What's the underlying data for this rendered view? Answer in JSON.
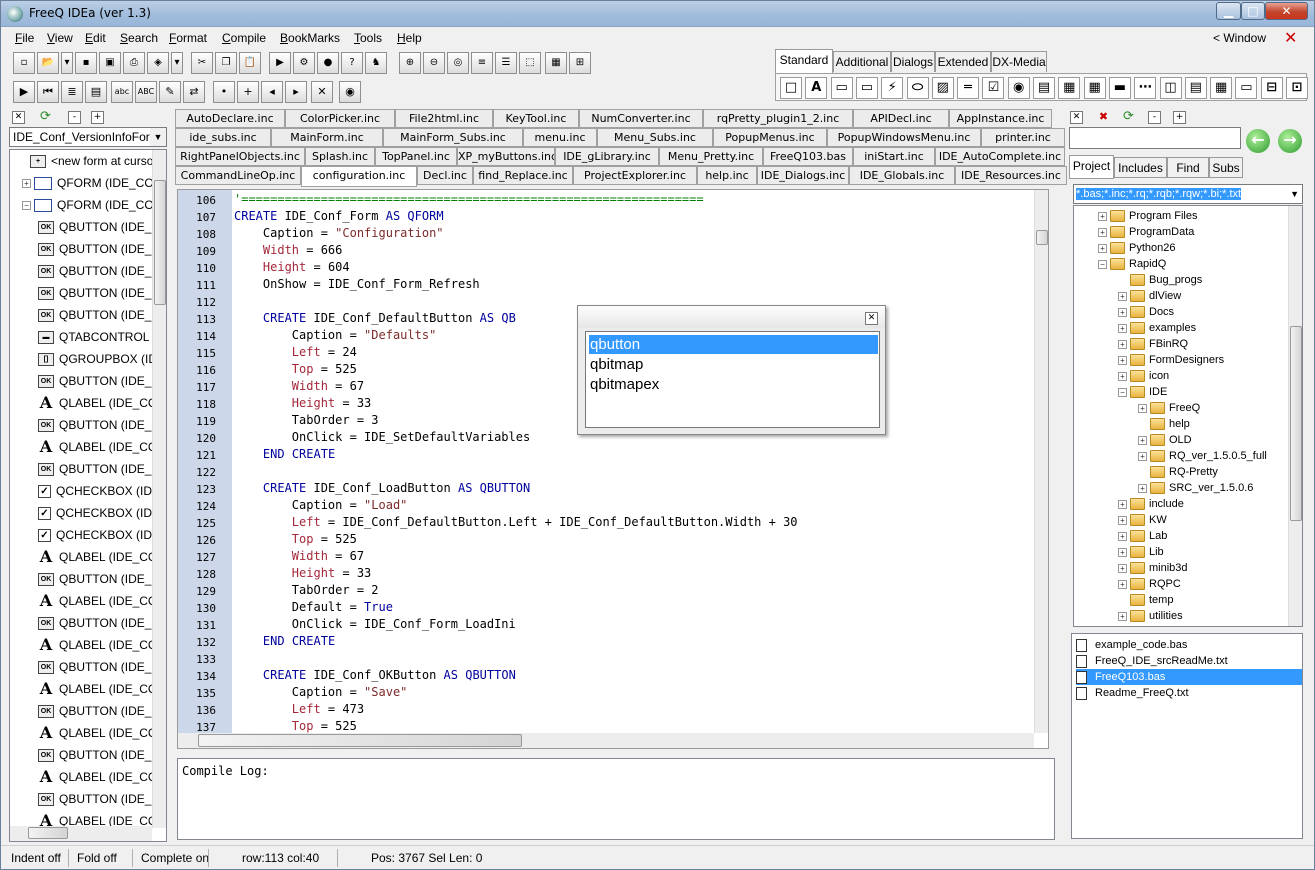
{
  "window": {
    "title": "FreeQ IDEa (ver 1.3)",
    "window_menu_label": "< Window",
    "close_glyph": "✕"
  },
  "menu": [
    "File",
    "View",
    "Edit",
    "Search",
    "Format",
    "Compile",
    "BookMarks",
    "Tools",
    "Help"
  ],
  "palette": {
    "tabs": [
      "Standard",
      "Additional",
      "Dialogs",
      "Extended",
      "DX-Media"
    ],
    "active_tab": 0
  },
  "left_panel": {
    "combo_value": "IDE_Conf_VersionInfoForm A",
    "tree_items": [
      {
        "icon": "new-form-icon",
        "label": "<new form at cursor>"
      },
      {
        "icon": "form-icon",
        "label": "QFORM  (IDE_CON"
      },
      {
        "icon": "form-icon",
        "label": "QFORM  (IDE_CON"
      },
      {
        "icon": "button-icon",
        "label": "QBUTTON  (IDE_"
      },
      {
        "icon": "button-icon",
        "label": "QBUTTON  (IDE_"
      },
      {
        "icon": "button-icon",
        "label": "QBUTTON  (IDE_"
      },
      {
        "icon": "button-icon",
        "label": "QBUTTON  (IDE_"
      },
      {
        "icon": "button-icon",
        "label": "QBUTTON  (IDE_"
      },
      {
        "icon": "tabcontrol-icon",
        "label": "QTABCONTROL"
      },
      {
        "icon": "groupbox-icon",
        "label": "QGROUPBOX  (ID"
      },
      {
        "icon": "button-icon",
        "label": "QBUTTON  (IDE_"
      },
      {
        "icon": "label-icon",
        "label": "QLABEL  (IDE_CC"
      },
      {
        "icon": "button-icon",
        "label": "QBUTTON  (IDE_"
      },
      {
        "icon": "label-icon",
        "label": "QLABEL  (IDE_CC"
      },
      {
        "icon": "button-icon",
        "label": "QBUTTON  (IDE_"
      },
      {
        "icon": "checkbox-icon",
        "label": "QCHECKBOX  (ID"
      },
      {
        "icon": "checkbox-icon",
        "label": "QCHECKBOX  (ID"
      },
      {
        "icon": "checkbox-icon",
        "label": "QCHECKBOX  (ID"
      },
      {
        "icon": "label-icon",
        "label": "QLABEL  (IDE_CC"
      },
      {
        "icon": "button-icon",
        "label": "QBUTTON  (IDE_"
      },
      {
        "icon": "label-icon",
        "label": "QLABEL  (IDE_CC"
      },
      {
        "icon": "button-icon",
        "label": "QBUTTON  (IDE_"
      },
      {
        "icon": "label-icon",
        "label": "QLABEL  (IDE_CC"
      },
      {
        "icon": "button-icon",
        "label": "QBUTTON  (IDE_"
      },
      {
        "icon": "label-icon",
        "label": "QLABEL  (IDE_CC"
      },
      {
        "icon": "button-icon",
        "label": "QBUTTON  (IDE_"
      },
      {
        "icon": "label-icon",
        "label": "QLABEL  (IDE_CC"
      },
      {
        "icon": "button-icon",
        "label": "QBUTTON  (IDE_"
      },
      {
        "icon": "label-icon",
        "label": "QLABEL  (IDE_CC"
      },
      {
        "icon": "button-icon",
        "label": "QBUTTON  (IDE_"
      },
      {
        "icon": "label-icon",
        "label": "QLABEL  (IDE_CC"
      }
    ]
  },
  "editor_tabs": [
    [
      "AutoDeclare.inc",
      "ColorPicker.inc",
      "File2html.inc",
      "KeyTool.inc",
      "NumConverter.inc",
      "rqPretty_plugin1_2.inc",
      "APIDecl.inc",
      "AppInstance.inc"
    ],
    [
      "ide_subs.inc",
      "MainForm.inc",
      "MainForm_Subs.inc",
      "menu.inc",
      "Menu_Subs.inc",
      "PopupMenus.inc",
      "PopupWindowsMenu.inc",
      "printer.inc"
    ],
    [
      "RightPanelObjects.inc",
      "Splash.inc",
      "TopPanel.inc",
      "XP_myButtons.inc",
      "IDE_gLibrary.inc",
      "Menu_Pretty.inc",
      "FreeQ103.bas",
      "iniStart.inc",
      "IDE_AutoComplete.inc"
    ],
    [
      "CommandLineOp.inc",
      "configuration.inc",
      "Decl.inc",
      "find_Replace.inc",
      "ProjectExplorer.inc",
      "help.inc",
      "IDE_Dialogs.inc",
      "IDE_Globals.inc",
      "IDE_Resources.inc"
    ]
  ],
  "active_editor_tab": "configuration.inc",
  "code": {
    "line_numbers": [
      "106",
      "107",
      "108",
      "109",
      "110",
      "111",
      "112",
      "113",
      "114",
      "115",
      "116",
      "117",
      "118",
      "119",
      "120",
      "121",
      "122",
      "123",
      "124",
      "125",
      "126",
      "127",
      "128",
      "129",
      "130",
      "131",
      "132",
      "133",
      "134",
      "135",
      "136",
      "137"
    ],
    "lines": [
      "'================================================================",
      "CREATE IDE_Conf_Form AS QFORM",
      "    Caption = \"Configuration\"",
      "    Width = 666",
      "    Height = 604",
      "    OnShow = IDE_Conf_Form_Refresh",
      "",
      "    CREATE IDE_Conf_DefaultButton AS QB",
      "        Caption = \"Defaults\"",
      "        Left = 24",
      "        Top = 525",
      "        Width = 67",
      "        Height = 33",
      "        TabOrder = 3",
      "        OnClick = IDE_SetDefaultVariables",
      "    END CREATE",
      "",
      "    CREATE IDE_Conf_LoadButton AS QBUTTON",
      "        Caption = \"Load\"",
      "        Left = IDE_Conf_DefaultButton.Left + IDE_Conf_DefaultButton.Width + 30",
      "        Top = 525",
      "        Width = 67",
      "        Height = 33",
      "        TabOrder = 2",
      "        Default = True",
      "        OnClick = IDE_Conf_Form_LoadIni",
      "    END CREATE",
      "",
      "    CREATE IDE_Conf_OKButton AS QBUTTON",
      "        Caption = \"Save\"",
      "        Left = 473",
      "        Top = 525"
    ]
  },
  "autocomplete": {
    "items": [
      "qbutton",
      "qbitmap",
      "qbitmapex"
    ],
    "selected": 0
  },
  "compile_log": {
    "label": "Compile Log:"
  },
  "right_panel": {
    "tabs": [
      "Project",
      "Includes",
      "Find",
      "Subs"
    ],
    "active_tab": 0,
    "filter": "*.bas;*.inc;*.rq;*.rqb;*.rqw;*.bi;*.txt",
    "folders": [
      {
        "label": "Program Files",
        "level": 1,
        "exp": "+"
      },
      {
        "label": "ProgramData",
        "level": 1,
        "exp": "+"
      },
      {
        "label": "Python26",
        "level": 1,
        "exp": "+"
      },
      {
        "label": "RapidQ",
        "level": 1,
        "exp": "−"
      },
      {
        "label": "Bug_progs",
        "level": 2,
        "exp": ""
      },
      {
        "label": "dlView",
        "level": 2,
        "exp": "+"
      },
      {
        "label": "Docs",
        "level": 2,
        "exp": "+"
      },
      {
        "label": "examples",
        "level": 2,
        "exp": "+"
      },
      {
        "label": "FBinRQ",
        "level": 2,
        "exp": "+"
      },
      {
        "label": "FormDesigners",
        "level": 2,
        "exp": "+"
      },
      {
        "label": "icon",
        "level": 2,
        "exp": "+"
      },
      {
        "label": "IDE",
        "level": 2,
        "exp": "−"
      },
      {
        "label": "FreeQ",
        "level": 3,
        "exp": "+"
      },
      {
        "label": "help",
        "level": 3,
        "exp": ""
      },
      {
        "label": "OLD",
        "level": 3,
        "exp": "+"
      },
      {
        "label": "RQ_ver_1.5.0.5_full",
        "level": 3,
        "exp": "+"
      },
      {
        "label": "RQ-Pretty",
        "level": 3,
        "exp": ""
      },
      {
        "label": "SRC_ver_1.5.0.6",
        "level": 3,
        "exp": "+"
      },
      {
        "label": "include",
        "level": 2,
        "exp": "+"
      },
      {
        "label": "KW",
        "level": 2,
        "exp": "+"
      },
      {
        "label": "Lab",
        "level": 2,
        "exp": "+"
      },
      {
        "label": "Lib",
        "level": 2,
        "exp": "+"
      },
      {
        "label": "minib3d",
        "level": 2,
        "exp": "+"
      },
      {
        "label": "RQPC",
        "level": 2,
        "exp": "+"
      },
      {
        "label": "temp",
        "level": 2,
        "exp": ""
      },
      {
        "label": "utilities",
        "level": 2,
        "exp": "+"
      }
    ],
    "files": [
      "example_code.bas",
      "FreeQ_IDE_srcReadMe.txt",
      "FreeQ103.bas",
      "Readme_FreeQ.txt"
    ],
    "selected_file": 2
  },
  "status": {
    "indent": "Indent off",
    "fold": "Fold off",
    "complete": "Complete on",
    "rowcol": "row:113 col:40",
    "pos": "Pos: 3767  Sel Len: 0"
  },
  "colors": {
    "accent": "#3399ff",
    "gutter": "#ccd7e9",
    "keyword": "#00009f",
    "string": "#7d2a2a"
  }
}
